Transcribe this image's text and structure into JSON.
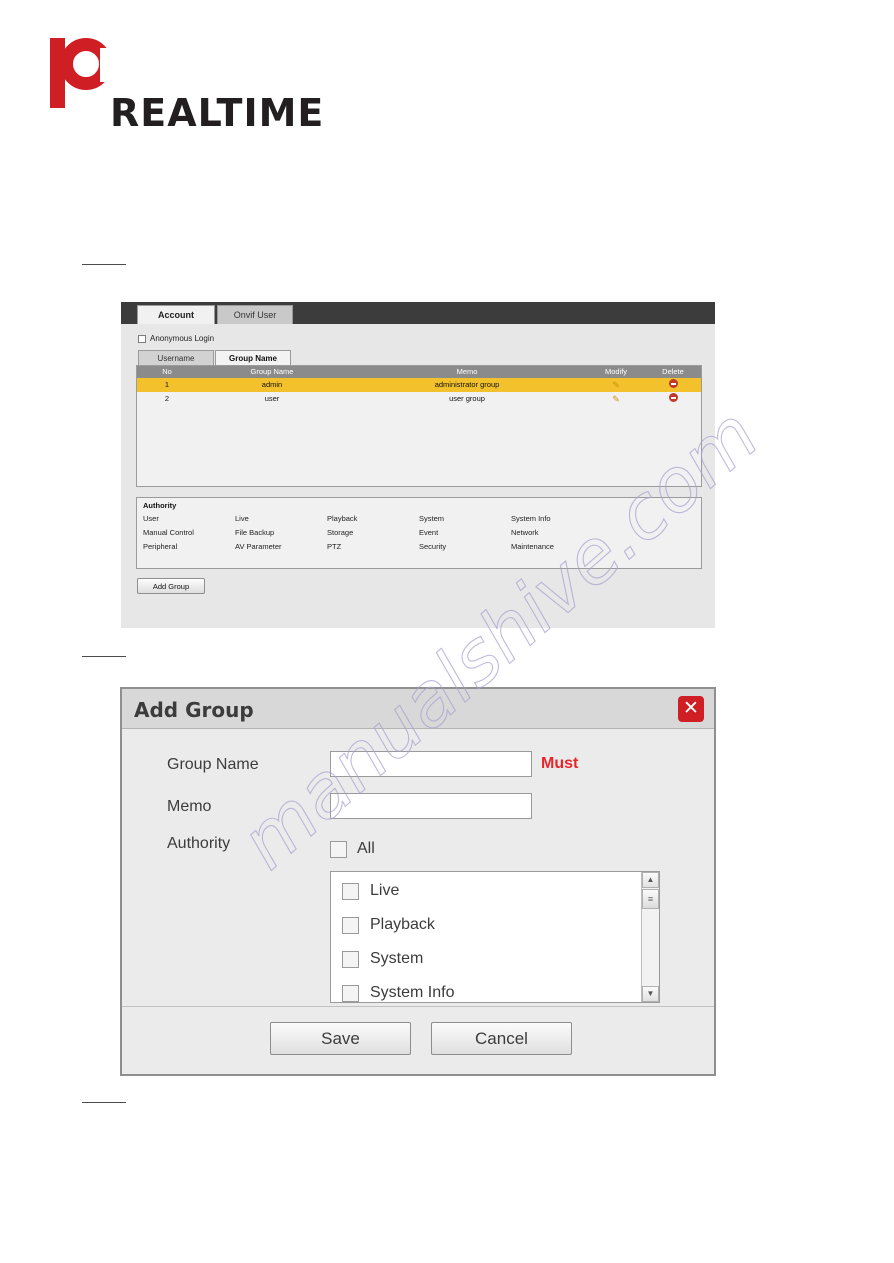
{
  "logo": {
    "text": "REALTIME",
    "mark": "IC"
  },
  "figure_account": {
    "tabs": [
      {
        "label": "Account",
        "active": true
      },
      {
        "label": "Onvif User",
        "active": false
      }
    ],
    "anonymous_login_label": "Anonymous Login",
    "subtabs": [
      {
        "label": "Username",
        "active": false
      },
      {
        "label": "Group Name",
        "active": true
      }
    ],
    "table": {
      "headers": [
        "No",
        "Group Name",
        "Memo",
        "Modify",
        "Delete"
      ],
      "rows": [
        {
          "no": "1",
          "group_name": "admin",
          "memo": "administrator group",
          "modify": "edit-icon",
          "delete": "delete-icon"
        },
        {
          "no": "2",
          "group_name": "user",
          "memo": "user group",
          "modify": "edit-icon",
          "delete": "delete-icon"
        }
      ]
    },
    "authority": {
      "title": "Authority",
      "items": [
        "User",
        "Live",
        "Playback",
        "System",
        "System Info",
        "Manual Control",
        "File Backup",
        "Storage",
        "Event",
        "Network",
        "Peripheral",
        "AV Parameter",
        "PTZ",
        "Security",
        "Maintenance"
      ]
    },
    "add_group_button": "Add Group"
  },
  "figure_add_group": {
    "title": "Add Group",
    "close_icon": "✕",
    "fields": [
      {
        "label": "Group Name",
        "value": "",
        "note": "Must"
      },
      {
        "label": "Memo",
        "value": ""
      }
    ],
    "authority_label": "Authority",
    "all_label": "All",
    "authority_items": [
      "Live",
      "Playback",
      "System",
      "System Info"
    ],
    "scroll": {
      "up": "▲",
      "down": "▼",
      "thumb": "≡"
    },
    "buttons": {
      "save": "Save",
      "cancel": "Cancel"
    }
  },
  "watermark": {
    "line1": "manualshive.com"
  }
}
